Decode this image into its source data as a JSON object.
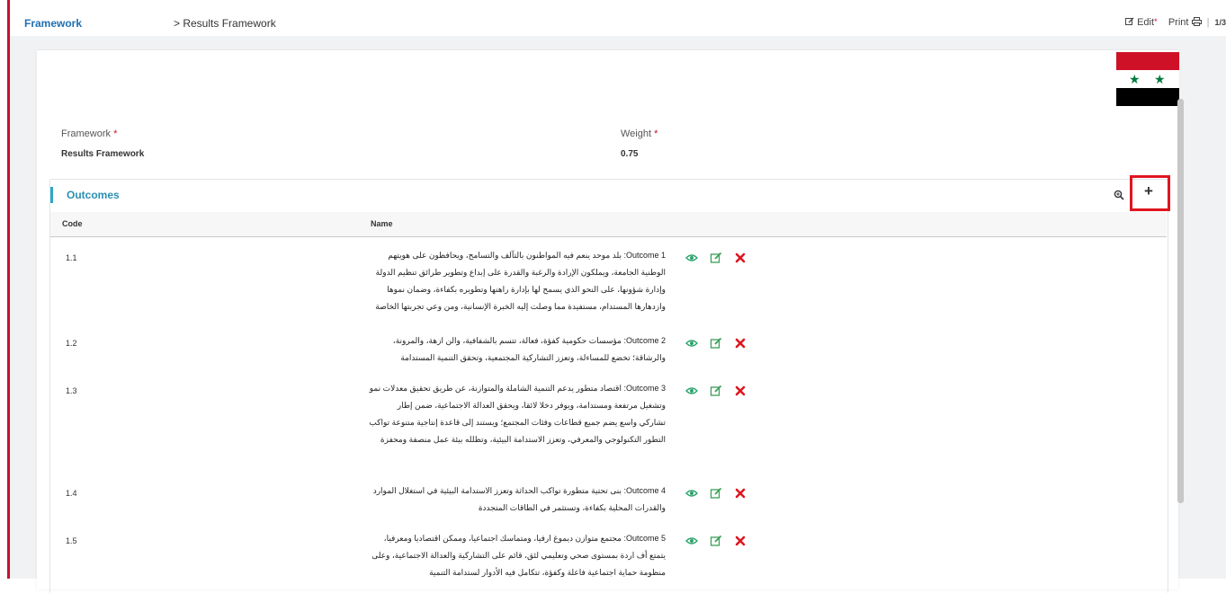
{
  "header": {
    "brand": "Framework",
    "breadcrumb": "> Results Framework",
    "edit_label": "Edit",
    "edit_marker": "*",
    "print_label": "Print",
    "separator": "|",
    "pagination": "1/3"
  },
  "form": {
    "framework_label": "Framework",
    "framework_value": "Results Framework",
    "weight_label": "Weight",
    "weight_value": "0.75",
    "required_marker": "*"
  },
  "outcomes": {
    "title": "Outcomes",
    "add_label": "+",
    "columns": {
      "code": "Code",
      "name": "Name"
    },
    "rows": [
      {
        "code": "1.1",
        "name": "Outcome 1: بلد موحد ينعم فيه المواطنون بالتآلف والتسامح، ويحافظون على هويتهم الوطنية الجامعة، ويملكون الإرادة والرغبة والقدرة على إبداع وتطوير طرائق تنظيم الدولة وإدارة شؤونها، على النحو الذي يسمح لها بإدارة راهنها وتطويره بكفاءة، وضمان نموها وازدهارها المستدام، مستفيدة مما وصلت إليه الخبرة الإنسانية، ومن وعي تجربتها الخاصة"
      },
      {
        "code": "1.2",
        "name": "Outcome 2: مؤسسات حكومية كفؤة، فعالة، تتسم بالشفافية، والن ازهة، والمرونة، والرشاقة؛ تخضع للمساءلة، وتعزز التشاركية المجتمعية، وتحقق التنمية المستدامة"
      },
      {
        "code": "1.3",
        "name": "Outcome 3: اقتصاد متطور يدعم التنمية الشاملة والمتوازنة، عن طريق تحقيق معدلات نمو وتشغيل مرتفعة ومستدامة، ويوفر دخلا لائقا، ويحقق العدالة الاجتماعية، ضمن إطار تشاركي واسع يضم جميع قطاعات وفئات المجتمع؛ ويستند إلى قاعدة إنتاجية متنوعة تواكب التطور التكنولوجي والمعرفي، وتعزز الاستدامة البيئية، وتظلله بيئة عمل منصفة ومحفزة"
      },
      {
        "code": "1.4",
        "name": "Outcome 4: بنى تحتية متطورة تواكب الحداثة وتعزز الاستدامة البيئية في استغلال الموارد والقدرات المحلية بكفاءة، وتستثمر في الطاقات المتجددة"
      },
      {
        "code": "1.5",
        "name": "Outcome 5: مجتمع متوازن ديموغ ارفيا، ومتماسك اجتماعيا، وممكن اقتصاديا ومعرفيا، يتمتع أف اردة بمستوى صحي وتعليمي لئق، قائم على التشاركية والعدالة الاجتماعية، وعلى منظومة حماية اجتماعية فاعلة وكفؤة، تتكامل فيه الأدوار لستدامة التنمية"
      }
    ]
  },
  "colors": {
    "accent": "#2a8fb4",
    "brand": "#1f6fb2",
    "danger": "#e0161f",
    "view": "#2aa36b",
    "edit": "#3a9e58"
  }
}
